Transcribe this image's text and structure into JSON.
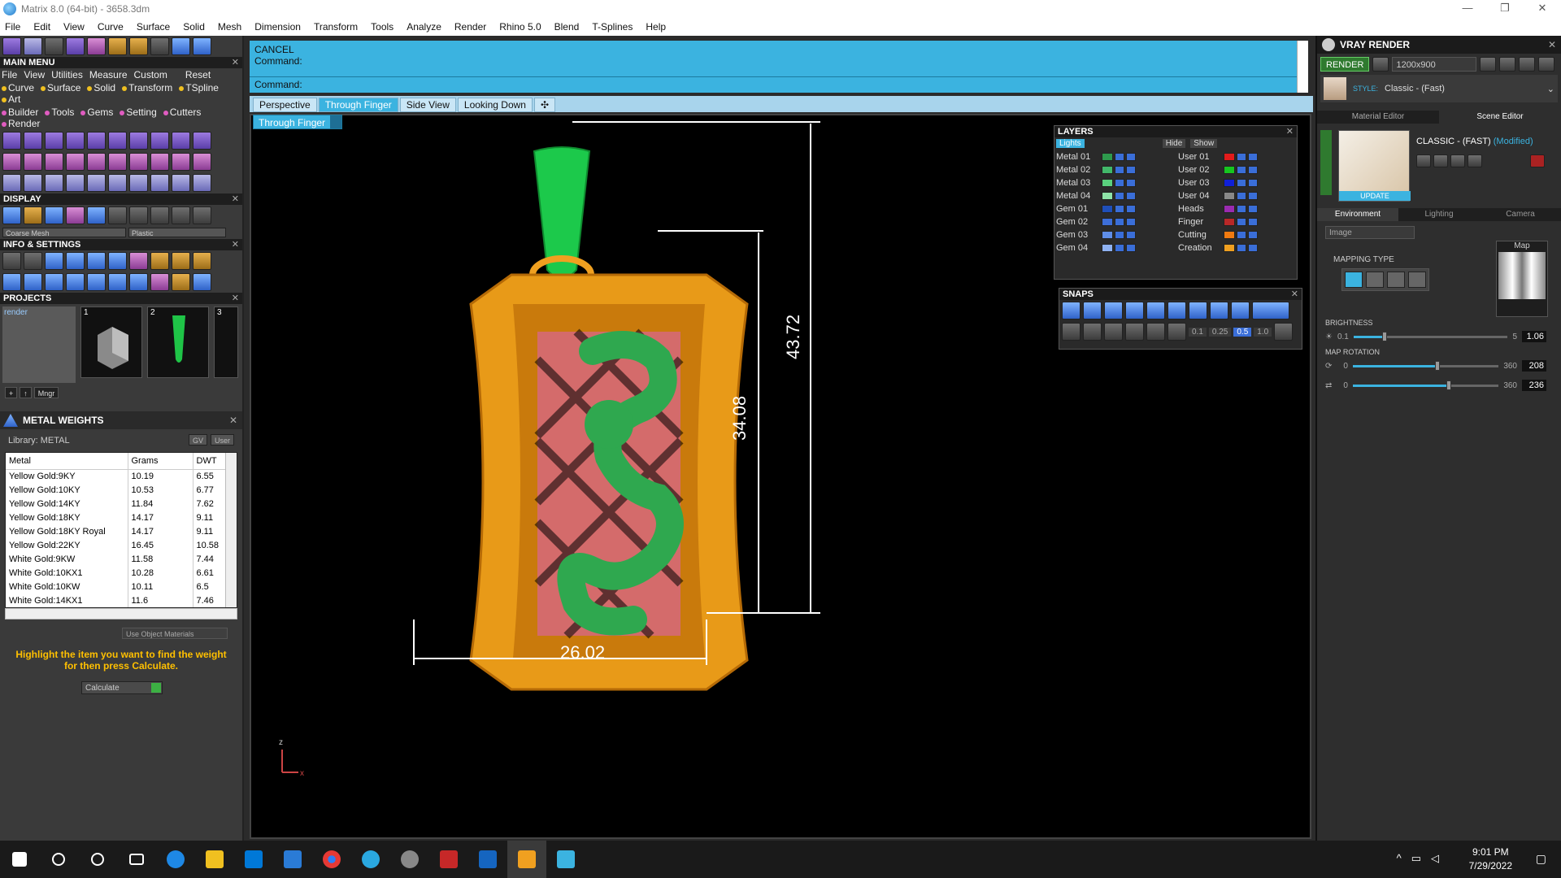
{
  "window": {
    "title": "Matrix 8.0 (64-bit) - 3658.3dm",
    "controls": [
      "—",
      "❐",
      "✕"
    ]
  },
  "menubar": [
    "File",
    "Edit",
    "View",
    "Curve",
    "Surface",
    "Solid",
    "Mesh",
    "Dimension",
    "Transform",
    "Tools",
    "Analyze",
    "Render",
    "Rhino 5.0",
    "Blend",
    "T-Splines",
    "Help"
  ],
  "left": {
    "main_menu_title": "MAIN MENU",
    "main_menu_row1": [
      "File",
      "View",
      "Utilities",
      "Measure",
      "Custom",
      "Reset"
    ],
    "main_menu_row2": [
      "Curve",
      "Surface",
      "Solid",
      "Transform",
      "TSpline",
      "Art"
    ],
    "main_menu_row3": [
      "Builder",
      "Tools",
      "Gems",
      "Setting",
      "Cutters",
      "Render"
    ],
    "display_title": "DISPLAY",
    "display_dd1": "Coarse Mesh",
    "display_dd2": "Plastic",
    "info_title": "INFO & SETTINGS",
    "projects_title": "PROJECTS",
    "project_list_item": "render",
    "project_thumbs": [
      "1",
      "2",
      "3"
    ],
    "project_mngr": "Mngr"
  },
  "metal_weights": {
    "title": "METAL WEIGHTS",
    "library": "Library: METAL",
    "toggle_gv": "GV",
    "toggle_user": "User",
    "columns": [
      "Metal",
      "Grams",
      "DWT"
    ],
    "rows": [
      [
        "Yellow Gold:9KY",
        "10.19",
        "6.55"
      ],
      [
        "Yellow Gold:10KY",
        "10.53",
        "6.77"
      ],
      [
        "Yellow Gold:14KY",
        "11.84",
        "7.62"
      ],
      [
        "Yellow Gold:18KY",
        "14.17",
        "9.11"
      ],
      [
        "Yellow Gold:18KY Royal",
        "14.17",
        "9.11"
      ],
      [
        "Yellow Gold:22KY",
        "16.45",
        "10.58"
      ],
      [
        "White Gold:9KW",
        "11.58",
        "7.44"
      ],
      [
        "White Gold:10KX1",
        "10.28",
        "6.61"
      ],
      [
        "White Gold:10KW",
        "10.11",
        "6.5"
      ],
      [
        "White Gold:14KX1",
        "11.6",
        "7.46"
      ]
    ],
    "use_object_materials": "Use Object Materials",
    "hint": "Highlight the item you want to find the weight for then press Calculate.",
    "calculate": "Calculate"
  },
  "command": {
    "cancel": "CANCEL",
    "line2": "Command:",
    "line3": "Command:"
  },
  "tabs": [
    "Perspective",
    "Through Finger",
    "Side View",
    "Looking Down",
    "✣"
  ],
  "active_tab": "Through Finger",
  "viewport_label": "Through Finger",
  "dimensions": {
    "width": "26.02",
    "inner_height": "34.08",
    "total_height": "43.72"
  },
  "axis": {
    "z": "z",
    "x": "x"
  },
  "layers": {
    "title": "LAYERS",
    "lights": "Lights",
    "hide": "Hide",
    "show": "Show",
    "left": [
      {
        "name": "Metal 01",
        "color": "#2e9a4d"
      },
      {
        "name": "Metal 02",
        "color": "#42b86a"
      },
      {
        "name": "Metal 03",
        "color": "#5ad07e"
      },
      {
        "name": "Metal 04",
        "color": "#8ee3a8"
      },
      {
        "name": "Gem 01",
        "color": "#1f4fb8"
      },
      {
        "name": "Gem 02",
        "color": "#3d6ed8"
      },
      {
        "name": "Gem 03",
        "color": "#5f8ee8"
      },
      {
        "name": "Gem 04",
        "color": "#8fb2f2"
      }
    ],
    "right": [
      {
        "name": "User 01",
        "color": "#e21b1b"
      },
      {
        "name": "User 02",
        "color": "#16c61f"
      },
      {
        "name": "User 03",
        "color": "#1020d8"
      },
      {
        "name": "User 04",
        "color": "#888888"
      },
      {
        "name": "Heads",
        "color": "#9a2bb0"
      },
      {
        "name": "Finger",
        "color": "#b82828"
      },
      {
        "name": "Cutting",
        "color": "#f07a10"
      },
      {
        "name": "Creation",
        "color": "#f0a020"
      }
    ]
  },
  "snaps": {
    "title": "SNAPS",
    "values": [
      "0.1",
      "0.25",
      "0.5",
      "1.0"
    ]
  },
  "vray": {
    "title": "VRAY RENDER",
    "render": "RENDER",
    "resolution": "1200x900",
    "style_label": "STYLE:",
    "style_value": "Classic - (Fast)",
    "tab_material": "Material Editor",
    "tab_scene": "Scene Editor",
    "scene_name": "CLASSIC - (FAST)",
    "scene_modified": "(Modified)",
    "update": "UPDATE",
    "env_tabs": [
      "Environment",
      "Lighting",
      "Camera"
    ],
    "image_dd": "Image",
    "map_label": "Map",
    "mapping_type": "MAPPING TYPE",
    "brightness": {
      "label": "BRIGHTNESS",
      "min": "0.1",
      "max": "5",
      "value": "1.06",
      "fraction": 0.2
    },
    "map_rotation": {
      "label": "MAP ROTATION",
      "min": "0",
      "max": "360",
      "value": "208",
      "fraction": 0.578
    },
    "map_rotation2": {
      "min": "0",
      "max": "360",
      "value": "236",
      "fraction": 0.656
    }
  },
  "taskbar": {
    "time": "9:01 PM",
    "date": "7/29/2022"
  },
  "colors": {
    "command_bg": "#3bb3e0",
    "gold": "#f0a020",
    "green": "#2fa84f",
    "lattice": "#d46b6b"
  }
}
